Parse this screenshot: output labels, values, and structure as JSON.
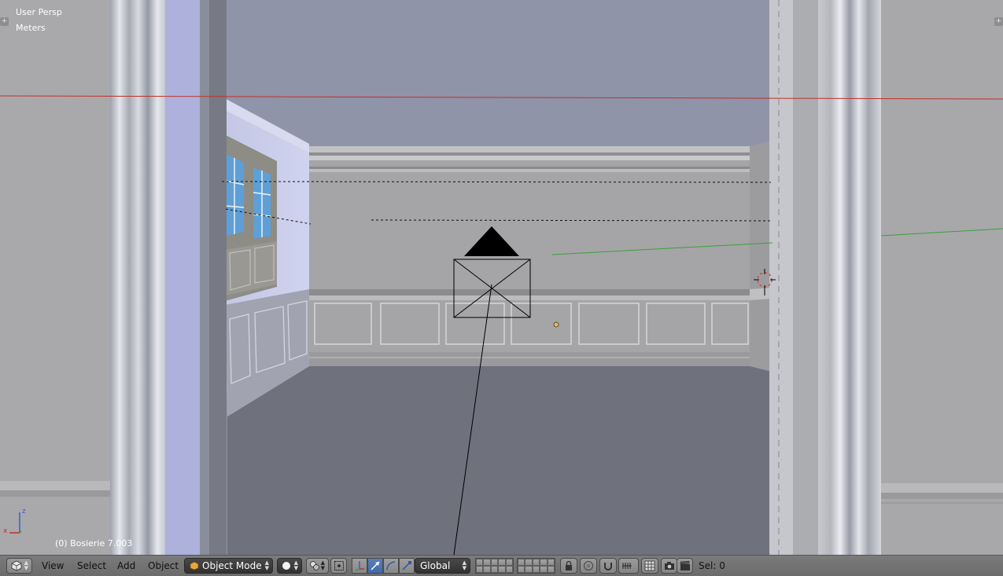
{
  "viewport": {
    "view_name": "User Persp",
    "units": "Meters",
    "object_info": "(0) Bosierie 7.003"
  },
  "toolbar": {
    "editor_type_icon": "cube-icon",
    "menus": [
      "View",
      "Select",
      "Add",
      "Object"
    ],
    "mode": "Object Mode",
    "shading_icon": "sphere-solid-icon",
    "pivot_icon": "pivot-circles-icon",
    "transform_orientation": "Global",
    "selection_status": "Sel: 0"
  },
  "colors": {
    "x_axis": "#c0302a",
    "y_axis": "#3aa03a",
    "z_axis": "#3a5ad0",
    "background": "#8f94a8"
  }
}
